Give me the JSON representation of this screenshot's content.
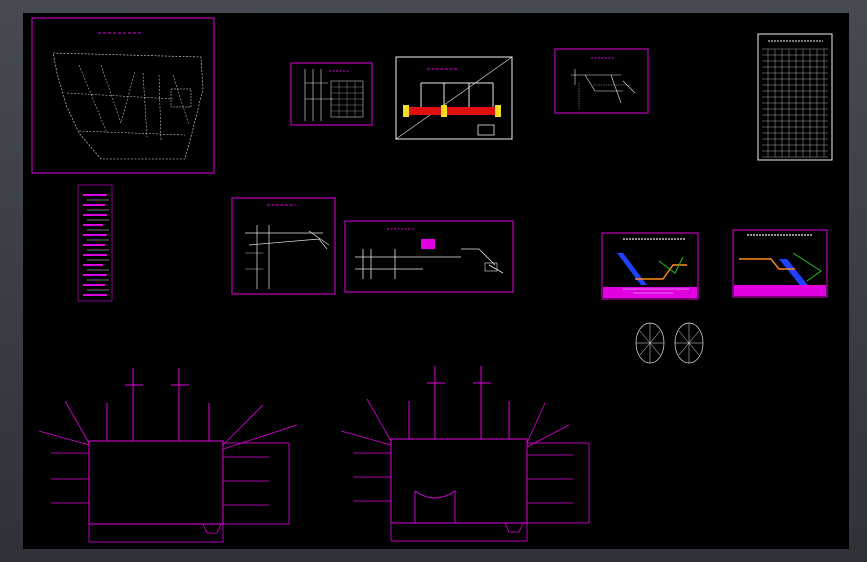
{
  "app": {
    "background": "#3a3d44",
    "canvas_color": "#000000"
  },
  "colors": {
    "frame_border": "#e000e0",
    "linework": "#e8e8e8",
    "accent_red": "#e01010",
    "accent_yellow": "#f0e020",
    "accent_blue": "#2040ff",
    "accent_green": "#20c020",
    "accent_orange": "#ff8c1a"
  },
  "sheets": {
    "plan": {
      "title": ""
    },
    "section_a": {
      "title": ""
    },
    "process": {
      "title": ""
    },
    "section_b": {
      "title": ""
    },
    "table": {
      "title": ""
    },
    "section_c": {
      "title": ""
    },
    "section_d": {
      "title": ""
    },
    "flow_1": {
      "title": ""
    },
    "flow_2": {
      "title": ""
    }
  }
}
